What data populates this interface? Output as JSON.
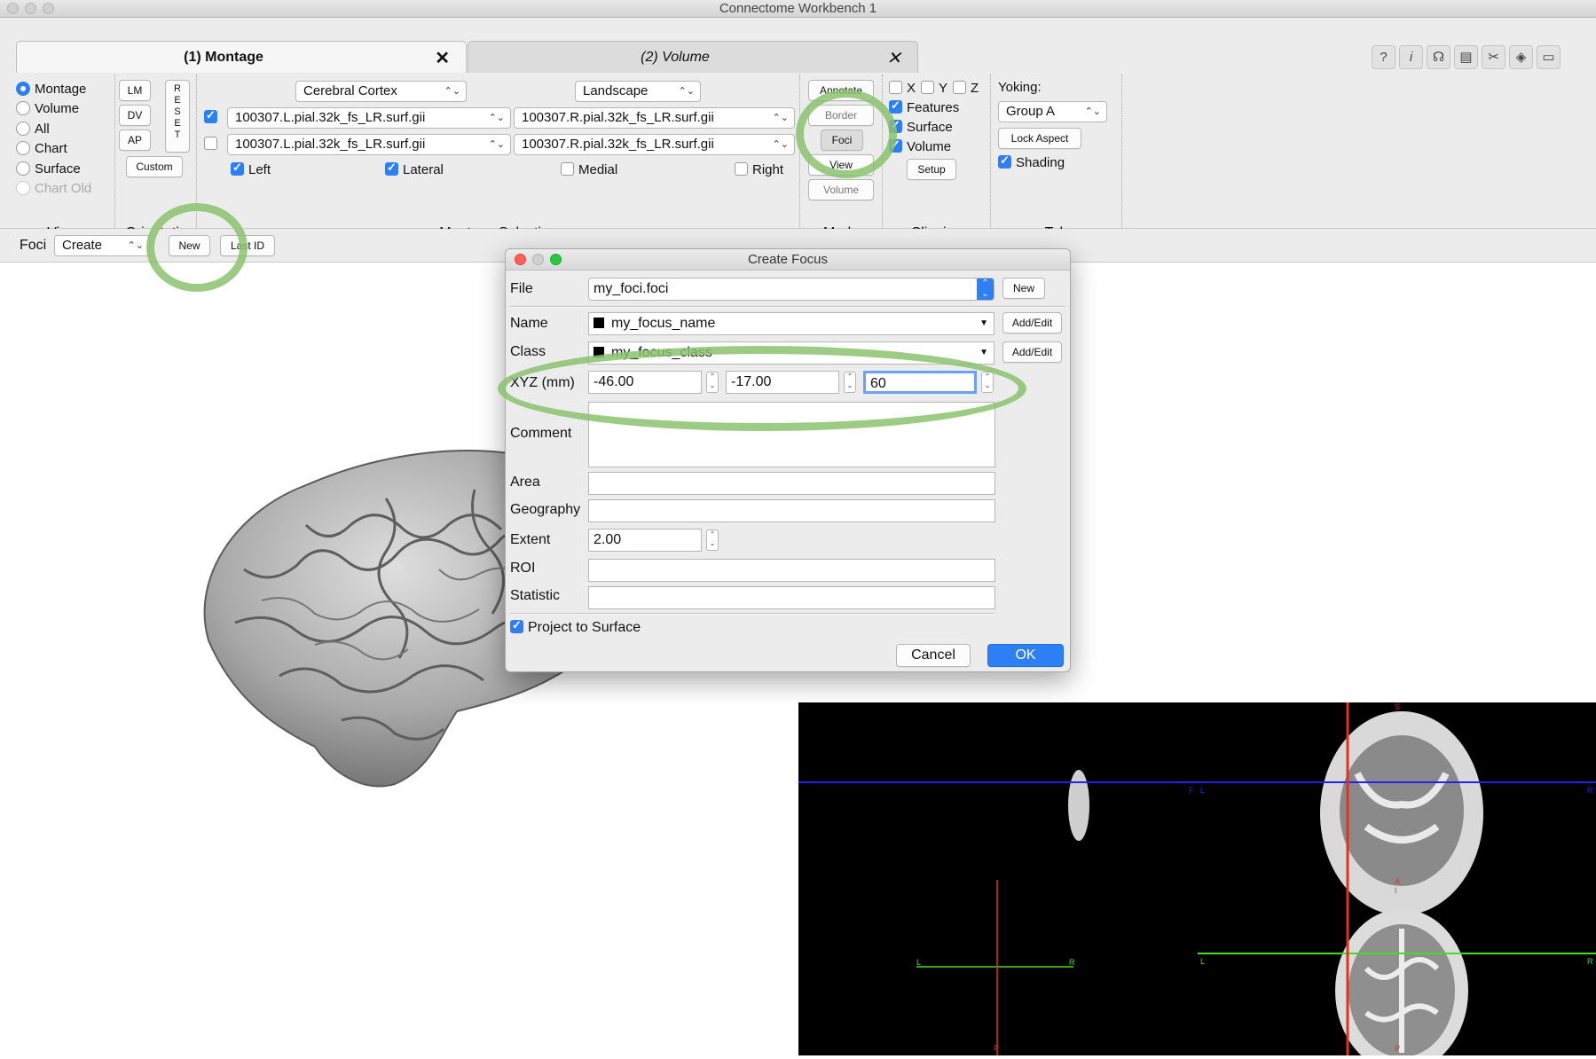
{
  "window": {
    "title": "Connectome Workbench 1"
  },
  "tabs": [
    {
      "label": "(1) Montage",
      "close": "✕"
    },
    {
      "label": "(2) Volume",
      "close": "✕"
    }
  ],
  "view": {
    "label": "View",
    "options": [
      "Montage",
      "Volume",
      "All",
      "Chart",
      "Surface",
      "Chart Old"
    ],
    "selected": "Montage"
  },
  "orientation": {
    "label": "Orientation",
    "buttons": [
      "LM",
      "DV",
      "AP"
    ],
    "reset": [
      "R",
      "E",
      "S",
      "E",
      "T"
    ],
    "custom": "Custom"
  },
  "montage": {
    "label": "Montage Selection",
    "structure": "Cerebral Cortex",
    "layout": "Landscape",
    "rows": [
      {
        "checked": true,
        "left": "100307.L.pial.32k_fs_LR.surf.gii",
        "right": "100307.R.pial.32k_fs_LR.surf.gii"
      },
      {
        "checked": false,
        "left": "100307.L.pial.32k_fs_LR.surf.gii",
        "right": "100307.R.pial.32k_fs_LR.surf.gii"
      }
    ],
    "checks": [
      {
        "label": "Left",
        "checked": true
      },
      {
        "label": "Lateral",
        "checked": true
      },
      {
        "label": "Medial",
        "checked": false
      },
      {
        "label": "Right",
        "checked": false
      }
    ]
  },
  "mode": {
    "label": "Mode",
    "buttons": [
      "Annotate",
      "Border",
      "Foci",
      "View",
      "Volume"
    ],
    "active": "Foci"
  },
  "clipping": {
    "label": "Clipping",
    "axes": [
      "X",
      "Y",
      "Z"
    ],
    "features": "Features",
    "surface": "Surface",
    "volume": "Volume",
    "setup": "Setup"
  },
  "tabgroup": {
    "label": "Tab",
    "yoking_label": "Yoking:",
    "yoking_value": "Group A",
    "lock_aspect": "Lock Aspect",
    "shading": "Shading"
  },
  "toolbar_icons": [
    "?",
    "i",
    "☊",
    "▤",
    "✂",
    "◈",
    "▭"
  ],
  "foci_bar": {
    "label": "Foci",
    "mode": "Create",
    "new_button": "New",
    "last_id_button": "Last ID"
  },
  "dialog": {
    "title": "Create Focus",
    "file_label": "File",
    "file_value": "my_foci.foci",
    "file_new": "New",
    "name_label": "Name",
    "name_value": "my_focus_name",
    "name_btn": "Add/Edit",
    "class_label": "Class",
    "class_value": "my_focus_class",
    "class_btn": "Add/Edit",
    "xyz_label": "XYZ (mm)",
    "x": "-46.00",
    "y": "-17.00",
    "z": "60",
    "comment_label": "Comment",
    "area_label": "Area",
    "geography_label": "Geography",
    "extent_label": "Extent",
    "extent_value": "2.00",
    "roi_label": "ROI",
    "statistic_label": "Statistic",
    "project_label": "Project to Surface",
    "cancel": "Cancel",
    "ok": "OK"
  },
  "mri_labels": {
    "s": "S",
    "a": "A",
    "p": "P",
    "i": "I",
    "l": "L",
    "r": "R",
    "f": "F"
  },
  "colors": {
    "accent": "#2d7ff6",
    "highlight": "#8bc26f",
    "crosshair_red": "#e0331f",
    "crosshair_blue": "#2222ee",
    "crosshair_green": "#44dd22"
  }
}
